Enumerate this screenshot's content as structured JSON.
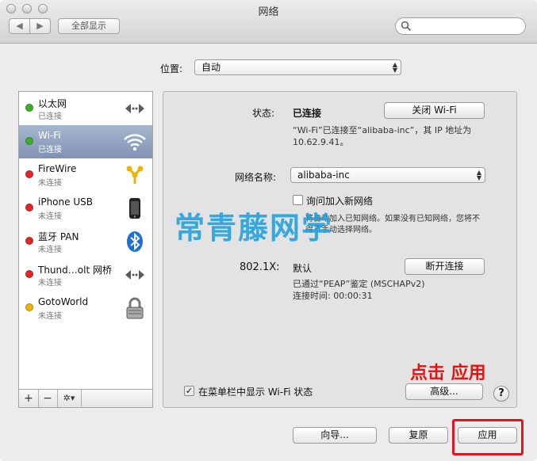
{
  "window": {
    "title": "网络",
    "show_all_label": "全部显示",
    "back_arrow": "◀",
    "forward_arrow": "▶"
  },
  "location": {
    "label": "位置:",
    "value": "自动"
  },
  "services": [
    {
      "name": "以太网",
      "status": "已连接",
      "dot_color": "#3fae2a",
      "icon": "ethernet-arrows-icon"
    },
    {
      "name": "Wi-Fi",
      "status": "已连接",
      "dot_color": "#3fae2a",
      "icon": "wifi-icon",
      "selected": true
    },
    {
      "name": "FireWire",
      "status": "未连接",
      "dot_color": "#e0272a",
      "icon": "firewire-icon"
    },
    {
      "name": "iPhone USB",
      "status": "未连接",
      "dot_color": "#e0272a",
      "icon": "iphone-icon"
    },
    {
      "name": "蓝牙 PAN",
      "status": "未连接",
      "dot_color": "#e0272a",
      "icon": "bluetooth-icon"
    },
    {
      "name": "Thund…olt 网桥",
      "status": "未连接",
      "dot_color": "#e0272a",
      "icon": "thunderbolt-bridge-arrows-icon"
    },
    {
      "name": "GotoWorld",
      "status": "未连接",
      "dot_color": "#f0b400",
      "icon": "lock-icon"
    }
  ],
  "sidebar_tools": {
    "add": "+",
    "remove": "−",
    "gear": "✲▾"
  },
  "detail": {
    "status_label": "状态:",
    "status_value": "已连接",
    "turn_off_button": "关闭 Wi-Fi",
    "status_desc_1": "“Wi-Fi”已连接至“alibaba-inc”，其 IP 地址为",
    "status_desc_2": "10.62.9.41。",
    "network_name_label": "网络名称:",
    "network_name_value": "alibaba-inc",
    "ask_join_label": "询问加入新网络",
    "ask_join_desc_1": "将自动加入已知网络。如果没有已知网络，您将不",
    "ask_join_desc_2": "得不手动选择网络。",
    "auth_label": "802.1X:",
    "auth_value": "默认",
    "disconnect_button": "断开连接",
    "auth_desc_1": "已通过“PEAP”鉴定 (MSCHAPv2)",
    "auth_desc_2": "连接时间: 00:00:31",
    "menu_checkbox_label": "在菜单栏中显示 Wi-Fi 状态",
    "advanced_button": "高级...",
    "help_button": "?"
  },
  "footer": {
    "assist_button": "向导...",
    "revert_button": "复原",
    "apply_button": "应用"
  },
  "overlays": {
    "watermark": "常青藤网学",
    "annotation": "点击 应用"
  }
}
